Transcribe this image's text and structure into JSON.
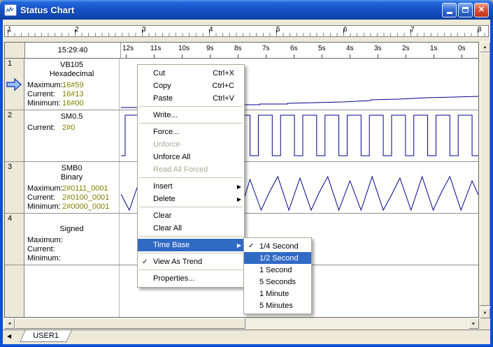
{
  "window": {
    "title": "Status Chart"
  },
  "ruler": {
    "numbers": [
      "1",
      "2",
      "3",
      "4",
      "5",
      "6",
      "7",
      "8"
    ]
  },
  "chart": {
    "timestamp": "15:29:40",
    "time_ticks": [
      "12s",
      "11s",
      "10s",
      "9s",
      "8s",
      "7s",
      "6s",
      "5s",
      "4s",
      "3s",
      "2s",
      "1s",
      "0s"
    ],
    "rows": [
      {
        "num": "1",
        "name": "VB105",
        "format": "Hexadecimal",
        "fields": [
          {
            "label": "Maximum:",
            "value": "16#59"
          },
          {
            "label": "Current:",
            "value": "16#13"
          },
          {
            "label": "Minimum:",
            "value": "16#00"
          }
        ]
      },
      {
        "num": "2",
        "name": "SM0.5",
        "format": "",
        "fields": [
          {
            "label": "Current:",
            "value": "2#0"
          }
        ]
      },
      {
        "num": "3",
        "name": "SMB0",
        "format": "Binary",
        "fields": [
          {
            "label": "Maximum:",
            "value": "2#0111_0001"
          },
          {
            "label": "Current:",
            "value": "2#0100_0001"
          },
          {
            "label": "Minimum:",
            "value": "2#0000_0001"
          }
        ]
      },
      {
        "num": "4",
        "name": "",
        "format": "Signed",
        "fields": [
          {
            "label": "Maximum:",
            "value": ""
          },
          {
            "label": "Current:",
            "value": ""
          },
          {
            "label": "Minimum:",
            "value": ""
          }
        ]
      }
    ],
    "trends": {
      "row1": "0,71 40,71 40,70 80,70 80,69 120,69 120,68 160,68 160,67 200,67 200,66 240,66 240,65 280,64 320,63 360,61 360,60 400,59 440,57 480,56 515,55",
      "row2": "0,140 6,140 6,82 26,82 26,140 38,140 38,82 58,82 58,140 70,140 70,82 90,82 90,140 102,140 102,82 122,82 122,140 134,140 134,82 154,82 154,140 166,140 166,82 186,82 186,140 198,140 198,82 218,82 218,140 230,140 230,82 250,82 250,140 262,140 262,82 282,82 282,140 294,140 294,82 314,82 314,140 326,140 326,82 346,82 346,140 358,140 358,82 378,82 378,140 390,140 390,82 410,82 410,140 422,140 422,82 442,82 442,140 454,140 454,82 474,82 474,140 486,140 486,82 506,82 506,140 515,140",
      "row3": "0,195 12,218 28,172 44,218 56,218 72,170 88,218 102,176 118,218 132,170 144,198 156,172 172,218 186,174 202,218 214,192 226,170 242,218 258,172 274,218 286,192 298,170 314,218 330,176 346,218 362,170 378,218 390,196 402,172 418,218 434,170 450,218 462,192 474,170 490,218 506,176 515,196"
    },
    "trend_color": "#00008B"
  },
  "context_menu": {
    "items": [
      {
        "label": "Cut",
        "shortcut": "Ctrl+X"
      },
      {
        "label": "Copy",
        "shortcut": "Ctrl+C"
      },
      {
        "label": "Paste",
        "shortcut": "Ctrl+V"
      },
      {
        "label": "Write..."
      },
      {
        "label": "Force..."
      },
      {
        "label": "Unforce",
        "disabled": true
      },
      {
        "label": "Unforce All"
      },
      {
        "label": "Read All Forced",
        "disabled": true
      },
      {
        "label": "Insert",
        "has_submenu": true
      },
      {
        "label": "Delete",
        "has_submenu": true
      },
      {
        "label": "Clear"
      },
      {
        "label": "Clear All"
      },
      {
        "label": "Time Base",
        "has_submenu": true,
        "highlighted": true
      },
      {
        "label": "View As Trend",
        "checked": true
      },
      {
        "label": "Properties..."
      }
    ]
  },
  "submenu": {
    "items": [
      {
        "label": "1/4 Second",
        "checked": true
      },
      {
        "label": "1/2 Second",
        "highlighted": true
      },
      {
        "label": "1 Second"
      },
      {
        "label": "5 Seconds"
      },
      {
        "label": "1 Minute"
      },
      {
        "label": "5 Minutes"
      }
    ]
  },
  "tab": {
    "label": "USER1"
  },
  "icons": {
    "check": "✓",
    "submenu_arrow": "▶",
    "up": "▲",
    "down": "▼",
    "left": "◄",
    "right": "►",
    "tab_scroll": "◀",
    "close": "✕"
  },
  "colors": {
    "titlebar": "#1753C8",
    "selection": "#316AC5",
    "value_text": "#808000",
    "trend_line": "#00008B",
    "client_background": "#ECE9D8"
  }
}
